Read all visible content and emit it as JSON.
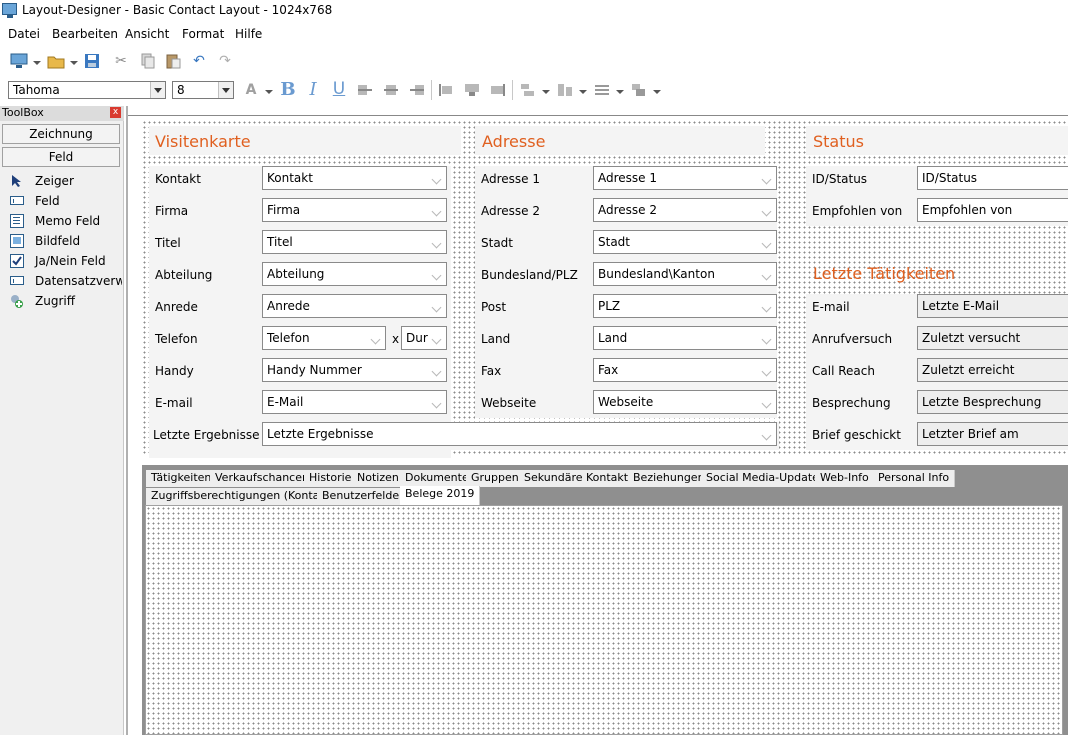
{
  "window": {
    "title": "Layout-Designer - Basic Contact Layout - 1024x768"
  },
  "menu": [
    "Datei",
    "Bearbeiten",
    "Ansicht",
    "Format",
    "Hilfe"
  ],
  "font": {
    "name": "Tahoma",
    "size": "8"
  },
  "toolbox": {
    "title": "ToolBox",
    "close": "x",
    "buttons": [
      "Zeichnung",
      "Feld"
    ],
    "items": [
      "Zeiger",
      "Feld",
      "Memo Feld",
      "Bildfeld",
      "Ja/Nein Feld",
      "Datensatzverwaltung",
      "Zugriff"
    ]
  },
  "visitenkarte": {
    "heading": "Visitenkarte",
    "rows": [
      {
        "label": "Kontakt",
        "value": "Kontakt"
      },
      {
        "label": "Firma",
        "value": "Firma"
      },
      {
        "label": "Titel",
        "value": "Titel"
      },
      {
        "label": "Abteilung",
        "value": "Abteilung"
      },
      {
        "label": "Anrede",
        "value": "Anrede"
      },
      {
        "label": "Telefon",
        "value": "Telefon",
        "extra_x": "x",
        "extra_value": "Durch"
      },
      {
        "label": "Handy",
        "value": "Handy Nummer"
      },
      {
        "label": "E-mail",
        "value": "E-Mail"
      }
    ],
    "last_result": {
      "label": "Letzte Ergebnisse",
      "value": "Letzte Ergebnisse"
    }
  },
  "adresse": {
    "heading": "Adresse",
    "rows": [
      {
        "label": "Adresse 1",
        "value": "Adresse 1"
      },
      {
        "label": "Adresse 2",
        "value": "Adresse 2"
      },
      {
        "label": "Stadt",
        "value": "Stadt"
      },
      {
        "label": "Bundesland/PLZ",
        "value": "Bundesland\\Kanton"
      },
      {
        "label": "Post",
        "value": "PLZ"
      },
      {
        "label": "Land",
        "value": "Land"
      },
      {
        "label": "Fax",
        "value": "Fax"
      },
      {
        "label": "Webseite",
        "value": "Webseite"
      }
    ]
  },
  "status": {
    "heading": "Status",
    "rows": [
      {
        "label": "ID/Status",
        "value": "ID/Status"
      },
      {
        "label": "Empfohlen von",
        "value": "Empfohlen von"
      }
    ]
  },
  "activities": {
    "heading": "Letzte Tätigkeiten",
    "rows": [
      {
        "label": "E-mail",
        "value": "Letzte E-Mail"
      },
      {
        "label": "Anrufversuch",
        "value": "Zuletzt versucht"
      },
      {
        "label": "Call Reach",
        "value": "Zuletzt erreicht"
      },
      {
        "label": "Besprechung",
        "value": "Letzte Besprechung"
      },
      {
        "label": "Brief geschickt",
        "value": "Letzter Brief am"
      }
    ]
  },
  "tabs": {
    "row1": [
      "Tätigkeiten",
      "Verkaufschancen",
      "Historie",
      "Notizen",
      "Dokumente",
      "Gruppen",
      "Sekundäre Kontakte",
      "Beziehungen",
      "Social Media-Updates",
      "Web-Info",
      "Personal Info"
    ],
    "row2": [
      "Zugriffsberechtigungen (Kontakt)",
      "Benutzerfelder",
      "Belege 2019"
    ],
    "active": "Belege 2019"
  }
}
